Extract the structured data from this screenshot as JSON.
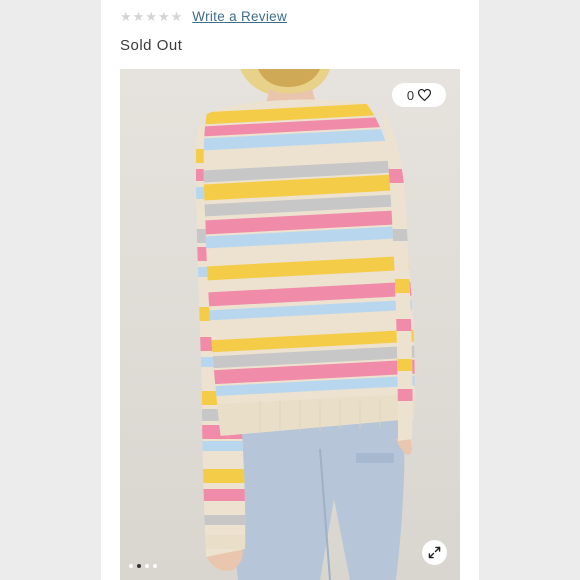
{
  "rating": {
    "stars": 5,
    "filled": 0,
    "icon": "star-icon",
    "link_label": "Write a Review"
  },
  "product": {
    "status": "Sold Out"
  },
  "gallery": {
    "favorite_count": "0",
    "favorite_icon": "heart-icon",
    "expand_icon": "expand-icon",
    "image_count": 4,
    "active_image": 2
  },
  "colors": {
    "link": "#3d6e8a",
    "star_empty": "#d4d4d4",
    "stripe_pink": "#f08caa",
    "stripe_yellow": "#f5cc48",
    "stripe_grey": "#c7c7c7",
    "stripe_blue": "#b8d7ef",
    "stripe_cream": "#ece2cf"
  }
}
